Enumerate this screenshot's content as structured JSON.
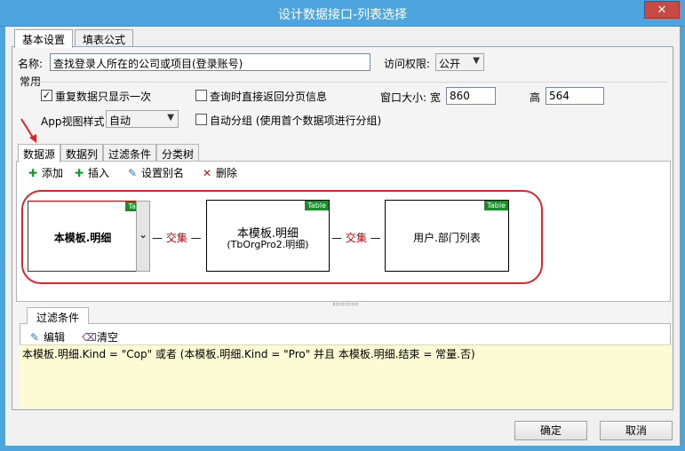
{
  "window": {
    "title": "设计数据接口-列表选择",
    "close_glyph": "✕"
  },
  "top_tabs": [
    {
      "label": "基本设置"
    },
    {
      "label": "填表公式"
    }
  ],
  "form": {
    "name_label": "名称:",
    "name_value": "查找登录人所在的公司或项目(登录账号)",
    "access_label": "访问权限:",
    "access_value": "公开",
    "group_title": "常用",
    "checkbox_dedupe": "重复数据只显示一次",
    "checkbox_dedupe_checked": true,
    "checkbox_pagination": "查询时直接返回分页信息",
    "checkbox_pagination_checked": false,
    "window_size_label": "窗口大小: 宽",
    "width_value": "860",
    "height_label": "高",
    "height_value": "564",
    "app_view_label": "App视图样式",
    "app_view_value": "自动",
    "checkbox_autogroup": "自动分组 (使用首个数据项进行分组)",
    "checkbox_autogroup_checked": false
  },
  "inner_tabs": [
    {
      "label": "数据源"
    },
    {
      "label": "数据列"
    },
    {
      "label": "过滤条件"
    },
    {
      "label": "分类树"
    }
  ],
  "toolbar": {
    "add": "添加",
    "insert": "插入",
    "alias": "设置别名",
    "delete": "删除"
  },
  "tables": [
    {
      "name": "本模板.明细",
      "sub": "",
      "badge": "Table"
    },
    {
      "name": "本模板.明细",
      "sub": "(TbOrgPro2.明细)",
      "badge": "Table"
    },
    {
      "name": "用户.部门列表",
      "sub": "",
      "badge": "Table"
    }
  ],
  "connectors": [
    {
      "label": "交集"
    },
    {
      "label": "交集"
    }
  ],
  "filter": {
    "tab_label": "过滤条件",
    "edit": "编辑",
    "clear": "清空",
    "expression": "本模板.明细.Kind = \"Cop\" 或者 (本模板.明细.Kind = \"Pro\" 并且 本模板.明细.结束 = 常量.否)"
  },
  "buttons": {
    "ok": "确定",
    "cancel": "取消"
  },
  "colors": {
    "titlebar": "#4ea4dc",
    "close": "#c74a45",
    "highlight": "#e0242a",
    "badge": "#1a8c2a",
    "expression_bg": "#fdfbd4"
  }
}
